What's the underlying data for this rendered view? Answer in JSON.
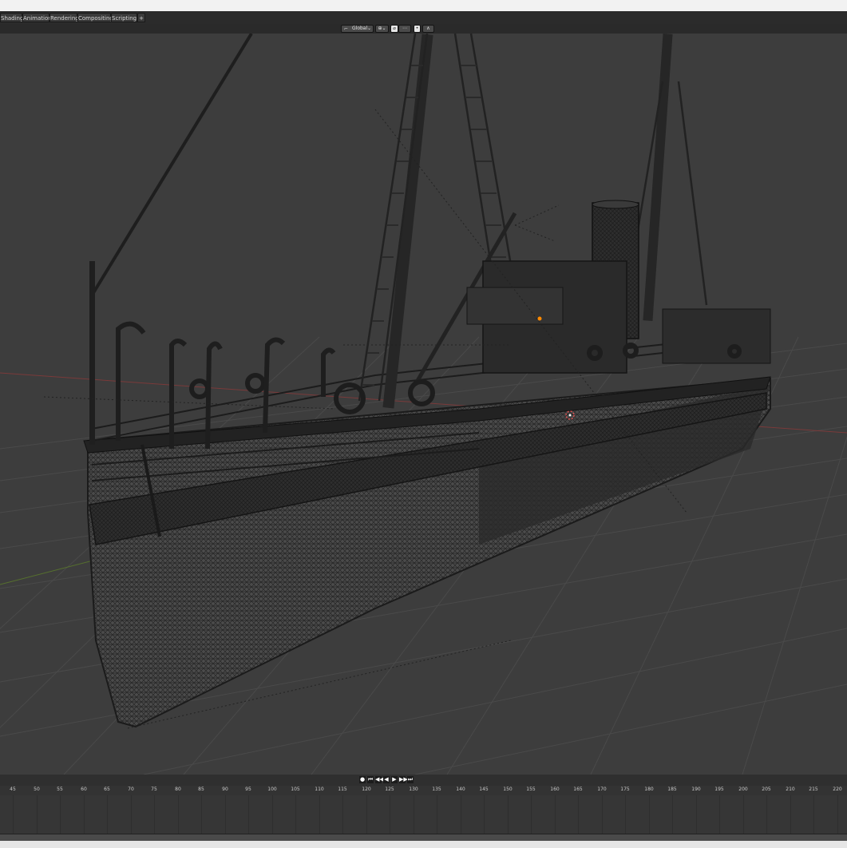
{
  "tabs": [
    {
      "label": "Shading"
    },
    {
      "label": "Animation"
    },
    {
      "label": "Rendering"
    },
    {
      "label": "Compositing"
    },
    {
      "label": "Scripting"
    },
    {
      "label": "+"
    }
  ],
  "viewport_header": {
    "orientation_label": "Global",
    "orientation_icon": "transform-orientation-icon",
    "pivot_icon": "pivot-point-icon",
    "snap_icon": "snap-icon",
    "proportional_icon": "proportional-editing-icon",
    "overlay_icon": "overlay-icon"
  },
  "viewport": {
    "background": "#3d3d3d",
    "grid_color": "#4a4a4a",
    "x_axis_color": "#8a3a3a",
    "y_axis_color": "#5a7a30",
    "mesh_color": "#1a1a1a",
    "origin_color": "#ff8a00",
    "cursor_color": "#e05050"
  },
  "timeline": {
    "playback_buttons": [
      "●",
      "⏮",
      "◀◀",
      "◀",
      "▶",
      "▶▶",
      "⏭"
    ],
    "frame_ticks": [
      "45",
      "50",
      "55",
      "60",
      "65",
      "70",
      "75",
      "80",
      "85",
      "90",
      "95",
      "100",
      "105",
      "110",
      "115",
      "120",
      "125",
      "130",
      "135",
      "140",
      "145",
      "150",
      "155",
      "160",
      "165",
      "170",
      "175",
      "180",
      "185",
      "190",
      "195",
      "200",
      "205",
      "210",
      "215",
      "220"
    ]
  }
}
